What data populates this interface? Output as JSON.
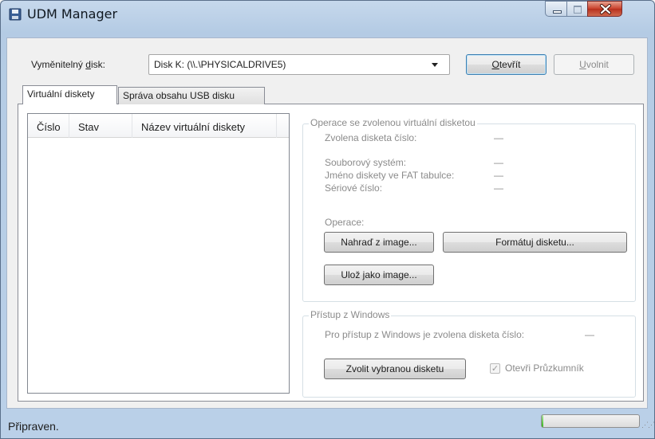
{
  "window": {
    "title": "UDM Manager"
  },
  "top": {
    "disk_label_pre": "Vyměnitelný ",
    "disk_label_u": "d",
    "disk_label_post": "isk:",
    "disk_value": "Disk K: (\\\\.\\PHYSICALDRIVE5)",
    "open_u": "O",
    "open_rest": "tevřít",
    "release_u": "U",
    "release_rest": "volnit"
  },
  "tabs": [
    "Virtuální diskety",
    "Správa obsahu USB disku"
  ],
  "list": {
    "columns": [
      "Číslo",
      "Stav",
      "Název virtuální diskety"
    ]
  },
  "ops_group": {
    "title": "Operace se zvolenou virtuální disketou",
    "selected_label": "Zvolena disketa číslo:",
    "selected_value": "—",
    "fs_label": "Souborový systém:",
    "fs_value": "—",
    "fat_label": "Jméno diskety ve FAT tabulce:",
    "fat_value": "—",
    "serial_label": "Sériové číslo:",
    "serial_value": "—",
    "ops_label": "Operace:",
    "replace_btn": "Nahraď z image...",
    "format_btn": "Formátuj disketu...",
    "save_btn": "Ulož jako image..."
  },
  "win_group": {
    "title": "Přístup z Windows",
    "text": "Pro přístup z Windows je zvolena disketa číslo:",
    "value": "—",
    "select_btn": "Zvolit vybranou disketu",
    "explorer_label": "Otevři Průzkumník",
    "explorer_checked": true
  },
  "status": {
    "text": "Připraven.",
    "progress": 0.02
  },
  "icons": {
    "app": "floppy-disk-icon",
    "dropdown": "chevron-down-icon"
  }
}
